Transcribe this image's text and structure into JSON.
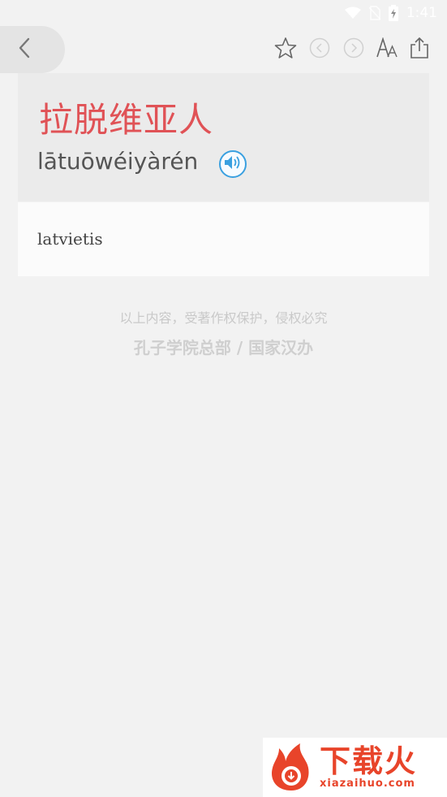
{
  "status_bar": {
    "time": "1:41",
    "icons": [
      "wifi-icon",
      "no-sim-icon",
      "battery-charging-icon"
    ]
  },
  "toolbar": {
    "icons": [
      "back-arrow-icon",
      "star-icon",
      "previous-icon",
      "next-icon",
      "font-size-icon",
      "share-icon"
    ]
  },
  "entry": {
    "word": "拉脱维亚人",
    "pinyin": "lātuōwéiyàrén",
    "definition": "latvietis"
  },
  "footer": {
    "copyright": "以上内容，受著作权保护，侵权必究",
    "publisher": "孔子学院总部 / 国家汉办"
  },
  "watermark": {
    "title": "下载火",
    "url": "xiazaihuo.com"
  },
  "colors": {
    "word": "#e05256",
    "audio": "#3aa0e0",
    "watermark": "#e8442a"
  }
}
